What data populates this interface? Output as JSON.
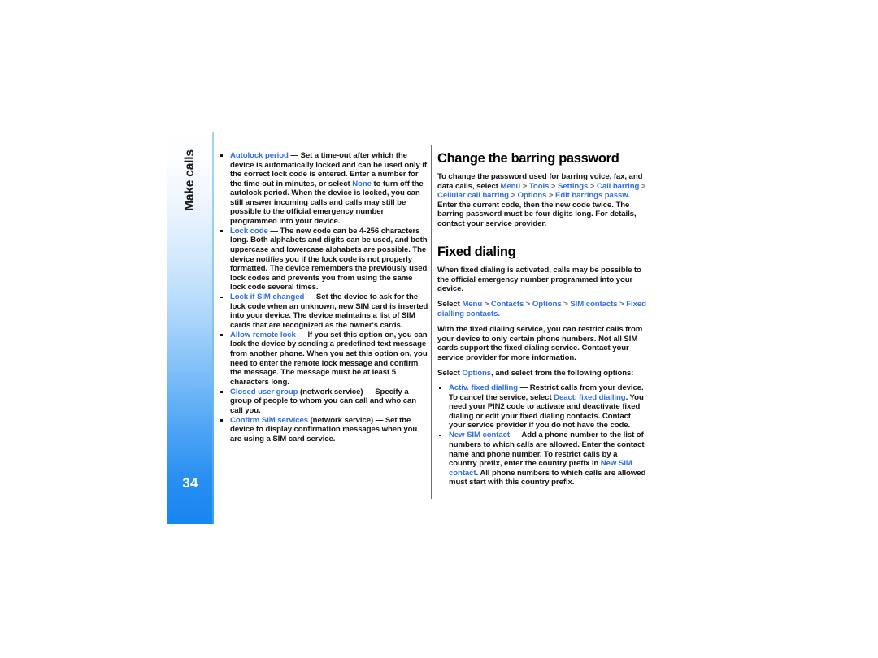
{
  "page": {
    "number": "34",
    "chapter_label": "Make calls",
    "accent_blue": "#2f6fe2",
    "tab_blue": "#1786f1",
    "tab_edge": "#8ccdf3",
    "divider_gray": "#6e6e6e"
  },
  "left_column": {
    "bullets": [
      {
        "term": "Autolock period",
        "dash": " — ",
        "body_1": "Set a time-out after which the device is automatically locked and can be used only if the correct lock code is entered. Enter a number for the time-out in minutes, or select ",
        "inline_ui": "None",
        "body_2": " to turn off the autolock period. When the device is locked, you can still answer incoming calls and calls may still be possible to the official emergency number programmed into your device."
      },
      {
        "term": "Lock code",
        "dash": " — ",
        "body_1": "The new code can be 4-256 characters long. Both alphabets and digits can be used, and both uppercase and lowercase alphabets are possible. The device notifies you if the lock code is not properly formatted. The device remembers the previously used lock codes and prevents you from using the same lock code several times."
      },
      {
        "term": "Lock if SIM changed",
        "dash": " — ",
        "body_1": "Set the device to ask for the lock code when an unknown, new SIM card is inserted into your device. The device maintains a list of SIM cards that are recognized as the owner's cards."
      },
      {
        "term": "Allow remote lock",
        "dash": " — ",
        "body_1": "If you set this option on, you can lock the device by sending a predefined text message from another phone. When you set this option on, you need to enter the remote lock message and confirm the message. The message must be at least 5 characters long."
      },
      {
        "term": "Closed user group",
        "dash": " (network service) — ",
        "body_1": "Specify a group of people to whom you can call and who can call you."
      },
      {
        "term": "Confirm SIM services",
        "dash": " (network service) — ",
        "body_1": "Set the device to display confirmation messages when you are using a SIM card service."
      }
    ]
  },
  "right_column": {
    "section_1": {
      "heading": "Change the barring password",
      "para_lead": "To change the password used for barring voice, fax, and data calls, select ",
      "path": [
        "Menu",
        "Tools",
        "Settings",
        "Call barring",
        "Cellular call barring",
        "Options",
        "Edit barrings passw."
      ],
      "path_separator": " > ",
      "para_tail": " Enter the current code, then the new code twice. The barring password must be four digits long. For details, contact your service provider."
    },
    "section_2": {
      "heading": "Fixed dialing",
      "para_1": "When fixed dialing is activated, calls may be possible to the official emergency number programmed into your device.",
      "select_lead": "Select ",
      "path": [
        "Menu",
        "Contacts",
        "Options",
        "SIM contacts",
        "Fixed dialling contacts"
      ],
      "path_separator": " > ",
      "path_tail": ".",
      "para_2": "With the fixed dialing service, you can restrict calls from your device to only certain phone numbers. Not all SIM cards support the fixed dialing service. Contact your service provider for more information.",
      "options_lead": "Select ",
      "options_ui": "Options",
      "options_tail": ", and select from the following options:",
      "bullets": [
        {
          "term": "Activ. fixed dialling",
          "dash": " — ",
          "body_1": "Restrict calls from your device. To cancel the service, select ",
          "inline_ui": "Deact. fixed dialling",
          "body_2": ". You need your PIN2 code to activate and deactivate fixed dialing or edit your fixed dialing contacts. Contact your service provider if you do not have the code."
        },
        {
          "term": "New SIM contact",
          "dash": " — ",
          "body_1": "Add a phone number to the list of numbers to which calls are allowed. Enter the contact name and phone number. To restrict calls by a country prefix, enter the country prefix in ",
          "inline_ui": "New SIM contact",
          "body_2": ". All phone numbers to which calls are allowed must start with this country prefix."
        }
      ]
    }
  }
}
